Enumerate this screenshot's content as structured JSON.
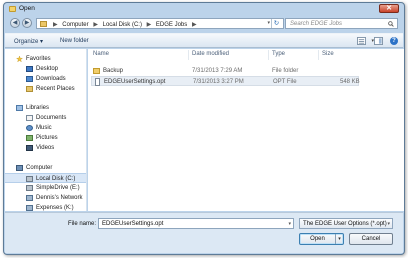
{
  "window": {
    "title": "Open",
    "close_glyph": "✕"
  },
  "address": {
    "crumbs": [
      "Computer",
      "Local Disk (C:)",
      "EDGE Jobs"
    ],
    "separator": "▶",
    "dropdown_glyph": "▾",
    "refresh_glyph": "↻"
  },
  "nav_buttons": {
    "back_glyph": "◀",
    "forward_glyph": "▶"
  },
  "search": {
    "placeholder": "Search EDGE Jobs"
  },
  "toolbar": {
    "organize_label": "Organize ▾",
    "new_folder_label": "New folder",
    "help_glyph": "?"
  },
  "sidebar": {
    "favorites_header": "Favorites",
    "favorites": [
      "Desktop",
      "Downloads",
      "Recent Places"
    ],
    "libraries_header": "Libraries",
    "libraries": [
      "Documents",
      "Music",
      "Pictures",
      "Videos"
    ],
    "computer_header": "Computer",
    "computer": [
      "Local Disk (C:)",
      "SimpleDrive (E:)",
      "Dennis's Network",
      "Expenses (K:)"
    ],
    "selected": "Local Disk (C:)"
  },
  "files": {
    "columns": {
      "name": "Name",
      "date": "Date modified",
      "type": "Type",
      "size": "Size"
    },
    "rows": [
      {
        "name": "Backup",
        "date": "7/31/2013 7:29 AM",
        "type": "File folder",
        "size": "",
        "kind": "folder"
      },
      {
        "name": "EDGEUserSettings.opt",
        "date": "7/31/2013 3:27 PM",
        "type": "OPT File",
        "size": "548 KB",
        "kind": "file",
        "selected": true
      }
    ]
  },
  "bottom": {
    "filename_label": "File name:",
    "filename_value": "EDGEUserSettings.opt",
    "filter_value": "The EDGE User Options (*.opt)",
    "open_label": "Open",
    "cancel_label": "Cancel",
    "dropdown_glyph": "▾"
  }
}
